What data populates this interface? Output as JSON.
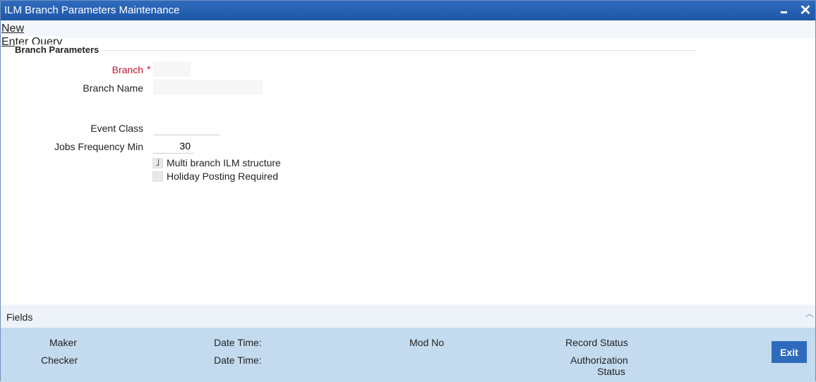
{
  "window": {
    "title": "ILM Branch Parameters Maintenance"
  },
  "menu": {
    "new_label": "New",
    "enter_query_label": "Enter Query"
  },
  "section": {
    "title": "Branch Parameters"
  },
  "form": {
    "branch_label": "Branch",
    "branch_required_marker": "*",
    "branch_value": "",
    "branch_name_label": "Branch Name",
    "branch_name_value": "",
    "event_class_label": "Event Class",
    "event_class_value": "",
    "jobs_frequency_label": "Jobs Frequency Min",
    "jobs_frequency_value": "30",
    "multi_branch_label": "Multi branch ILM structure",
    "multi_branch_checked": true,
    "holiday_posting_label": "Holiday Posting Required",
    "holiday_posting_checked": false
  },
  "footer": {
    "fields_label": "Fields",
    "maker_label": "Maker",
    "checker_label": "Checker",
    "date_time_label_1": "Date Time:",
    "date_time_label_2": "Date Time:",
    "mod_no_label": "Mod No",
    "record_status_label": "Record Status",
    "authorization_label": "Authorization",
    "status_label": "Status",
    "exit_label": "Exit"
  },
  "colors": {
    "titlebar": "#1f57a8",
    "required": "#c8102e",
    "audit_bg": "#c4dbef",
    "exit_button": "#2f6bbd"
  }
}
